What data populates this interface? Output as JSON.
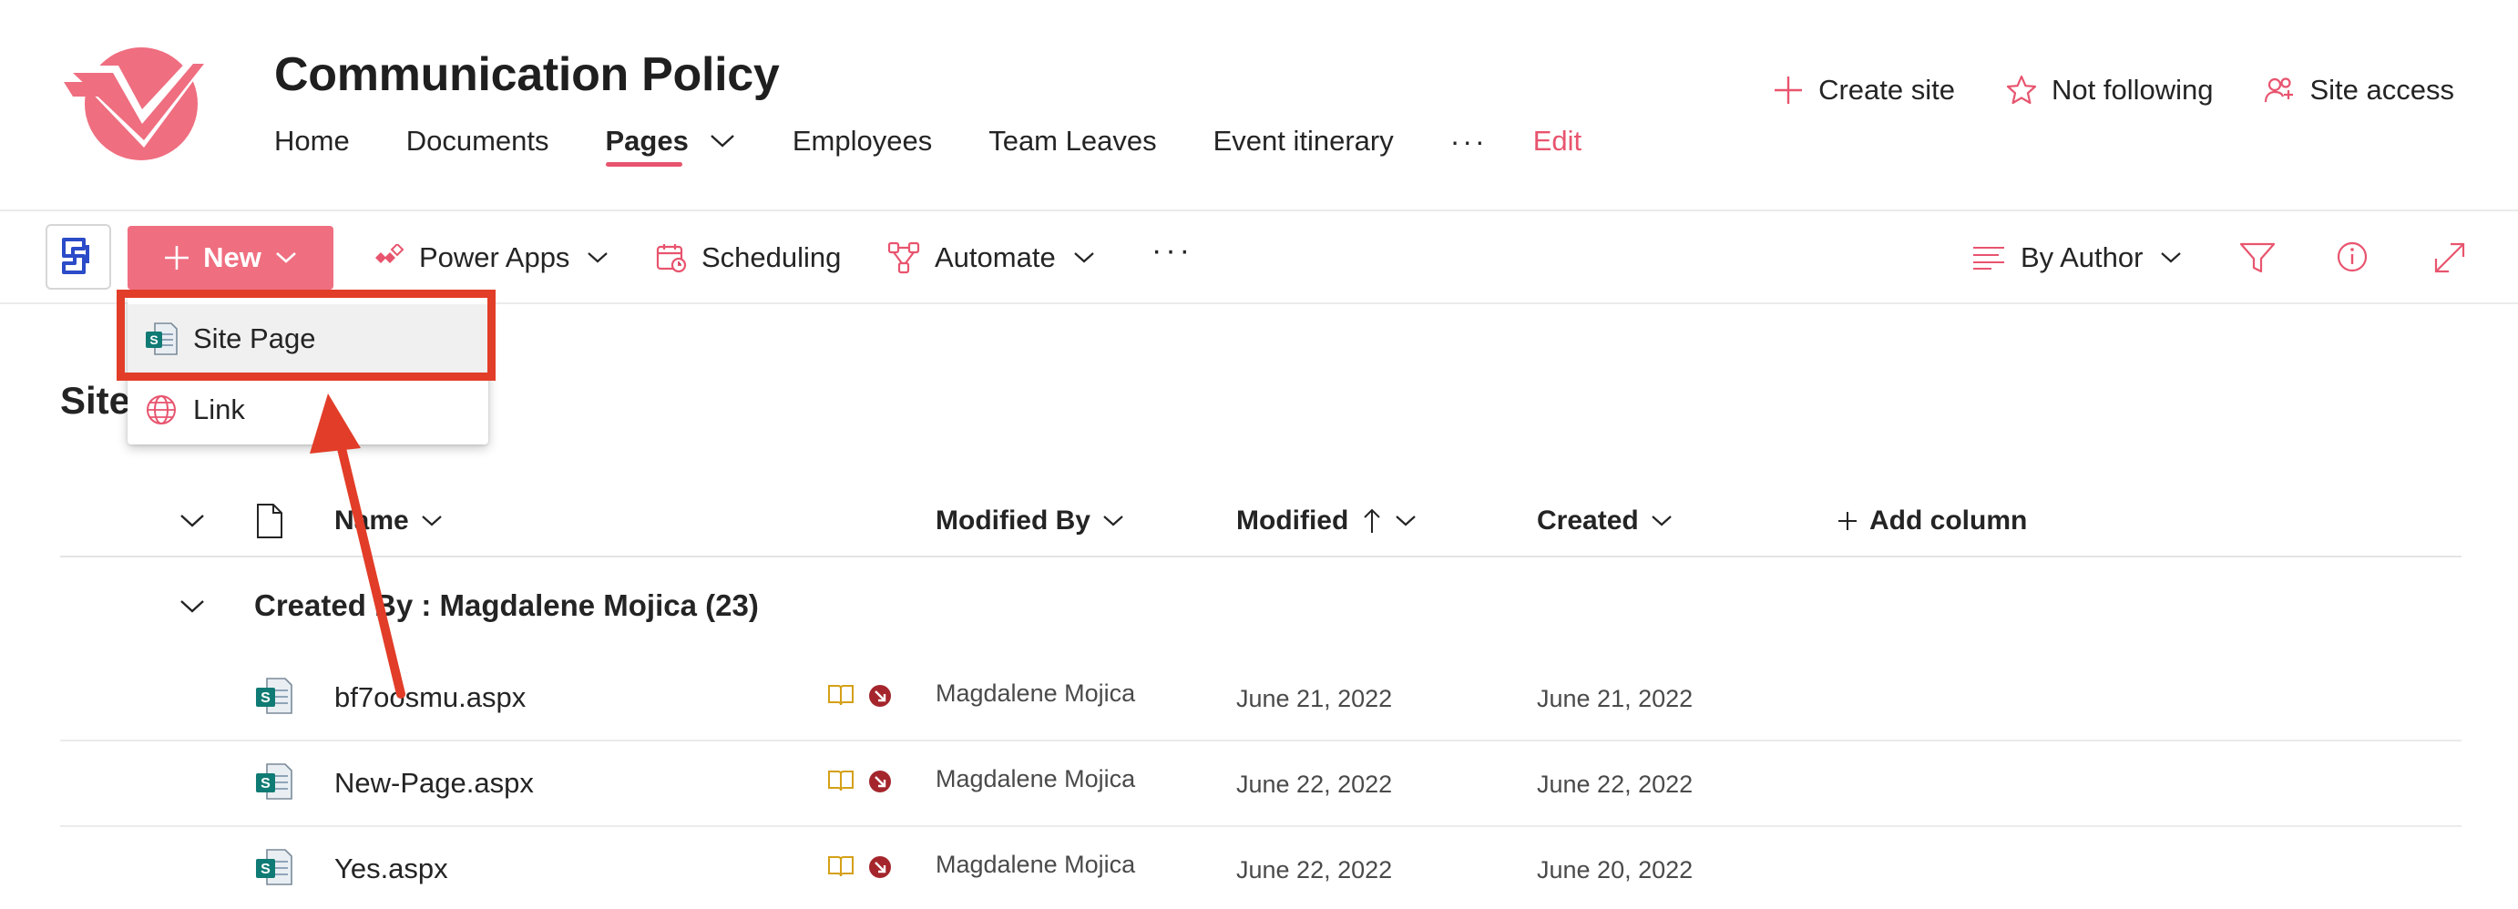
{
  "site": {
    "title": "Communication Policy",
    "accent_color": "#e8546e",
    "nav": [
      {
        "label": "Home"
      },
      {
        "label": "Documents"
      },
      {
        "label": "Pages"
      },
      {
        "label": "Employees"
      },
      {
        "label": "Team Leaves"
      },
      {
        "label": "Event itinerary"
      }
    ],
    "nav_more": "···",
    "nav_edit": "Edit",
    "actions": {
      "create_site": "Create site",
      "not_following": "Not following",
      "site_access": "Site access"
    }
  },
  "command_bar": {
    "new_label": "New",
    "new_button_color": "#ef6e80",
    "power_apps": "Power Apps",
    "scheduling": "Scheduling",
    "automate": "Automate",
    "more": "···",
    "view": "By Author"
  },
  "new_menu": {
    "items": [
      {
        "label": "Site Page",
        "icon": "sharepoint-page-icon"
      },
      {
        "label": "Link",
        "icon": "globe-icon"
      }
    ],
    "annotation_color": "#e23d28"
  },
  "section": {
    "title_visible": "Site"
  },
  "list": {
    "columns": {
      "name": "Name",
      "modified_by": "Modified By",
      "modified": "Modified",
      "created": "Created",
      "add_column": "Add column"
    },
    "group_label": "Created By : Magdalene Mojica (23)",
    "rows": [
      {
        "name": "bf7oosmu.aspx",
        "modified_by": "Magdalene Mojica",
        "modified": "June 21, 2022",
        "created": "June 21, 2022"
      },
      {
        "name": "New-Page.aspx",
        "modified_by": "Magdalene Mojica",
        "modified": "June 22, 2022",
        "created": "June 22, 2022"
      },
      {
        "name": "Yes.aspx",
        "modified_by": "Magdalene Mojica",
        "modified": "June 22, 2022",
        "created": "June 20, 2022"
      }
    ]
  }
}
